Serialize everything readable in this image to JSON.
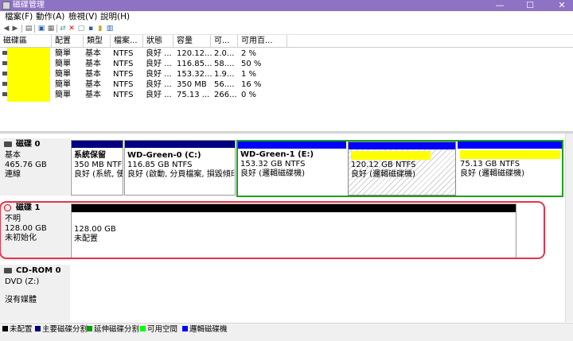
{
  "window": {
    "title": "磁碟管理",
    "minimize": "—",
    "maximize": "☐",
    "close": "✕"
  },
  "menu": [
    {
      "label": "檔案(F)"
    },
    {
      "label": "動作(A)"
    },
    {
      "label": "檢視(V)"
    },
    {
      "label": "說明(H)"
    }
  ],
  "toolbar": [
    "back-icon",
    "forward-icon",
    "console-tree-icon",
    "help-icon",
    "properties-icon",
    "connect-icon",
    "delete-icon",
    "refresh-icon",
    "export-icon",
    "extend-icon",
    "settings-icon"
  ],
  "volume_table": {
    "columns": [
      "磁碟區",
      "配置",
      "類型",
      "檔案...",
      "狀態",
      "容量",
      "可...",
      "可用百..."
    ],
    "rows": [
      {
        "name": "",
        "layout": "簡單",
        "type": "基本",
        "fs": "NTFS",
        "status": "良好 ...",
        "capacity": "120.12...",
        "free": "2.0...",
        "pct": "2 %"
      },
      {
        "name": "",
        "layout": "簡單",
        "type": "基本",
        "fs": "NTFS",
        "status": "良好 ...",
        "capacity": "116.85...",
        "free": "58....",
        "pct": "50 %"
      },
      {
        "name": "",
        "layout": "簡單",
        "type": "基本",
        "fs": "NTFS",
        "status": "良好 ...",
        "capacity": "153.32...",
        "free": "1.9...",
        "pct": "1 %"
      },
      {
        "name": "",
        "layout": "簡單",
        "type": "基本",
        "fs": "NTFS",
        "status": "良好 ...",
        "capacity": "350 MB",
        "free": "56....",
        "pct": "16 %"
      },
      {
        "name": "",
        "layout": "簡單",
        "type": "基本",
        "fs": "NTFS",
        "status": "良好 ...",
        "capacity": "75.13 ...",
        "free": "266...",
        "pct": "0 %"
      }
    ]
  },
  "disks": {
    "disk0": {
      "name": "磁碟 0",
      "type": "基本",
      "size": "465.76 GB",
      "status": "連線",
      "partitions": [
        {
          "name": "系統保留",
          "size": "350 MB NTFS",
          "status": "良好 (系統, 使月"
        },
        {
          "name": "WD-Green-0  (C:)",
          "size": "116.85 GB NTFS",
          "status": "良好 (啟動, 分頁檔案, 損毀傾印,"
        },
        {
          "name": "WD-Green-1  (E:)",
          "size": "153.32 GB NTFS",
          "status": "良好 (邏輯磁碟機)"
        },
        {
          "name": "",
          "size": "120.12 GB NTFS",
          "status": "良好 (邏輯磁碟機)"
        },
        {
          "name": "",
          "size": "75.13 GB NTFS",
          "status": "良好 (邏輯磁碟機)"
        }
      ]
    },
    "disk1": {
      "name": "磁碟 1",
      "type": "不明",
      "size": "128.00 GB",
      "status": "未初始化",
      "partitions": [
        {
          "size": "128.00 GB",
          "status": "未配置"
        }
      ]
    },
    "cdrom0": {
      "name": "CD-ROM 0",
      "type": "DVD (Z:)",
      "status": "沒有媒體"
    }
  },
  "legend": [
    {
      "label": "未配置",
      "color": "#000000"
    },
    {
      "label": "主要磁碟分割",
      "color": "#000080"
    },
    {
      "label": "延伸磁碟分割",
      "color": "#00a000"
    },
    {
      "label": "可用空間",
      "color": "#00ff00"
    },
    {
      "label": "邏輯磁碟機",
      "color": "#0000ff"
    }
  ]
}
